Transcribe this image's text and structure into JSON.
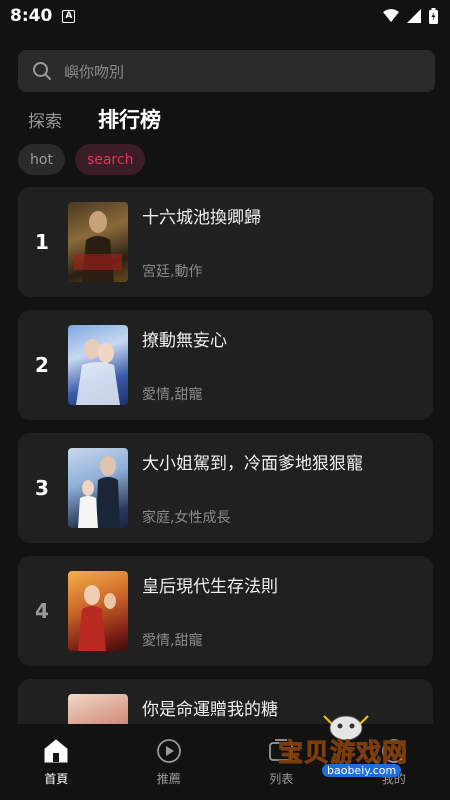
{
  "status": {
    "time": "8:40",
    "a_icon": "A"
  },
  "search": {
    "placeholder": "嶼你吻別"
  },
  "tabs": {
    "explore": "探索",
    "ranking": "排行榜"
  },
  "chips": {
    "hot": "hot",
    "search": "search"
  },
  "colors": {
    "accent": "#e8315e",
    "card_bg": "#202020",
    "page_bg": "#121212"
  },
  "items": [
    {
      "rank": "1",
      "title": "十六城池換卿歸",
      "tags": "宮廷,動作",
      "rank_color": "#ffffff"
    },
    {
      "rank": "2",
      "title": "撩動無妄心",
      "tags": "愛情,甜寵",
      "rank_color": "#ffffff"
    },
    {
      "rank": "3",
      "title": "大小姐駕到，冷面爹地狠狠寵",
      "tags": "家庭,女性成長",
      "rank_color": "#ffffff"
    },
    {
      "rank": "4",
      "title": "皇后現代生存法則",
      "tags": "愛情,甜寵",
      "rank_color": "#9a9a9a"
    },
    {
      "rank": "",
      "title": "你是命運贈我的糖",
      "tags": "",
      "rank_color": "#9a9a9a"
    }
  ],
  "nav": [
    {
      "label": "首頁",
      "icon": "home-icon",
      "active": true
    },
    {
      "label": "推薦",
      "icon": "play-circle-icon",
      "active": false
    },
    {
      "label": "列表",
      "icon": "list-icon",
      "active": false
    },
    {
      "label": "我的",
      "icon": "profile-icon",
      "active": false
    }
  ],
  "watermark": {
    "text": "宝贝游戏网",
    "url": "baobeiy.com"
  }
}
